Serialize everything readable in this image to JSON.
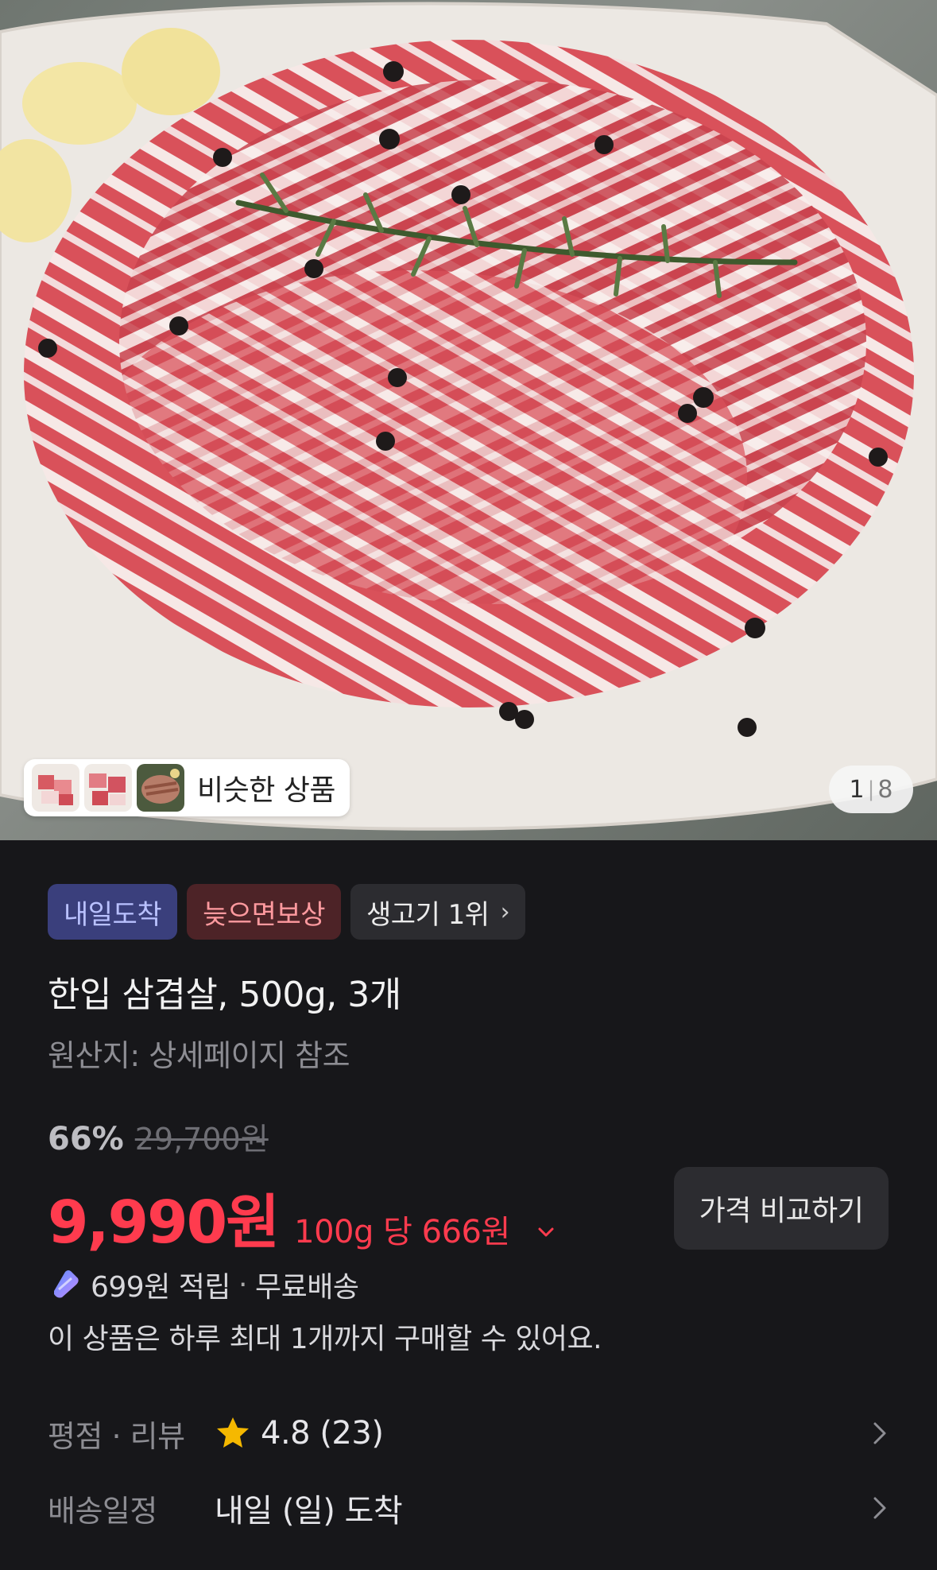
{
  "hero": {
    "similar_label": "비슷한 상품",
    "pager_current": "1",
    "pager_total": "8",
    "thumbnails": [
      "meat-cubes-thumb",
      "meat-cubes-thumb",
      "grilled-meat-thumb"
    ]
  },
  "badges": {
    "arrival": "내일도착",
    "compensation": "늦으면보상",
    "rank": "생고기 1위"
  },
  "product": {
    "title": "한입 삼겹살, 500g, 3개",
    "origin": "원산지: 상세페이지 참조",
    "discount_rate": "66%",
    "original_price": "29,700원",
    "price": "9,990원",
    "unit_price": "100g 당 666원",
    "compare_button": "가격 비교하기",
    "reward": "699원 적립",
    "shipping": "무료배송",
    "purchase_limit": "이 상품은 하루 최대 1개까지 구매할 수 있어요."
  },
  "info": {
    "rating_label": "평점 · 리뷰",
    "rating_value": "4.8 (23)",
    "delivery_label": "배송일정",
    "delivery_value": "내일 (일) 도착"
  },
  "colors": {
    "price_red": "#ff3b4e",
    "background": "#17171a",
    "badge_blue_bg": "#3a3f7c",
    "badge_red_bg": "#4d2327",
    "star": "#f5b800"
  },
  "icons": [
    "chevron-right-icon",
    "chevron-down-icon",
    "reward-coin-icon",
    "star-icon"
  ]
}
